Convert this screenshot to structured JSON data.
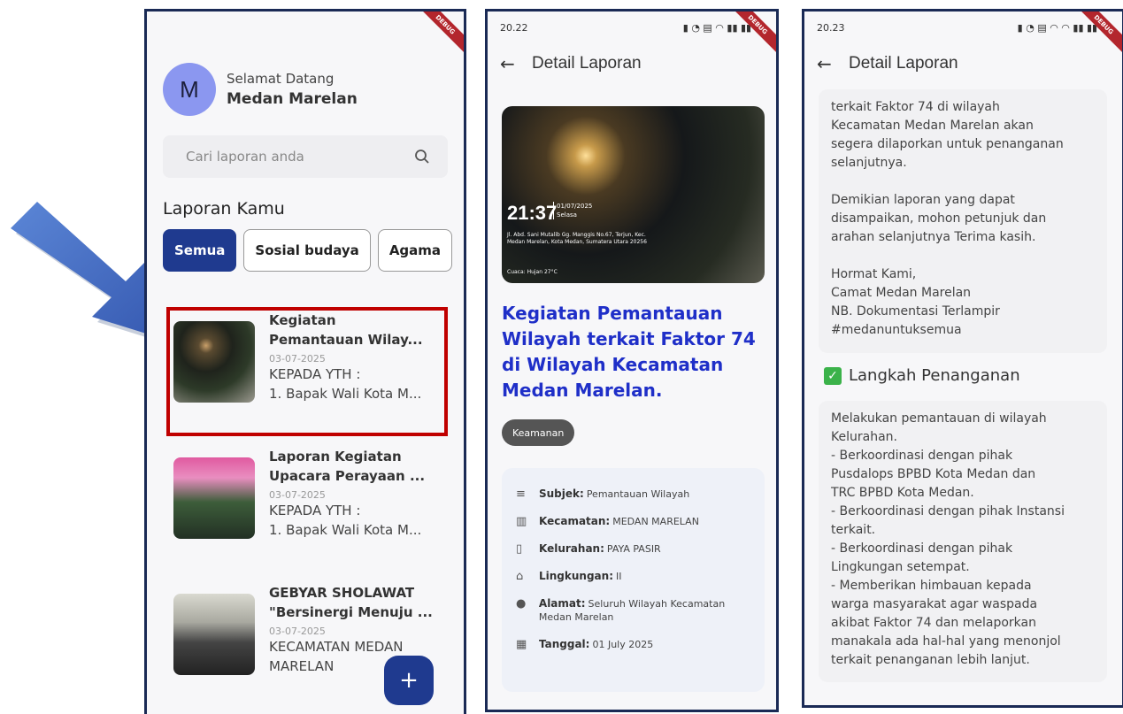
{
  "screen1": {
    "greeting": "Selamat Datang",
    "user_name": "Medan Marelan",
    "avatar_letter": "M",
    "search_placeholder": "Cari laporan anda",
    "section_title": "Laporan Kamu",
    "chips": [
      "Semua",
      "Sosial budaya",
      "Agama"
    ],
    "reports": [
      {
        "title": "Kegiatan\nPemantauan Wilay...",
        "date": "03-07-2025",
        "body": "KEPADA YTH :\n1. Bapak Wali Kota M..."
      },
      {
        "title": "Laporan Kegiatan\nUpacara Perayaan ...",
        "date": "03-07-2025",
        "body": "KEPADA YTH :\n1. Bapak Wali Kota M..."
      },
      {
        "title": "GEBYAR SHOLAWAT\n\"Bersinergi Menuju ...",
        "date": "03-07-2025",
        "body": "KECAMATAN MEDAN\nMARELAN"
      }
    ],
    "fab_label": "+"
  },
  "screen2": {
    "status_time": "20.22",
    "title": "Detail Laporan",
    "photo": {
      "time": "21:37",
      "date": "01/07/2025",
      "day": "Selasa",
      "address": "Jl. Abd. Sani Mutalib Gg. Manggis No.67, Terjun, Kec. Medan Marelan, Kota Medan, Sumatera Utara 20256",
      "weather": "Cuaca: Hujan 27°C"
    },
    "report_title": "Kegiatan Pemantauan Wilayah terkait Faktor 74 di Wilayah Kecamatan Medan Marelan.",
    "tag": "Keamanan",
    "info": {
      "subjek_label": "Subjek:",
      "subjek": "Pemantauan Wilayah",
      "kecamatan_label": "Kecamatan:",
      "kecamatan": "MEDAN MARELAN",
      "kelurahan_label": "Kelurahan:",
      "kelurahan": "PAYA PASIR",
      "lingkungan_label": "Lingkungan:",
      "lingkungan": "II",
      "alamat_label": "Alamat:",
      "alamat": "Seluruh Wilayah Kecamatan Medan Marelan",
      "tanggal_label": "Tanggal:",
      "tanggal": "01 July 2025"
    }
  },
  "screen3": {
    "status_time": "20.23",
    "title": "Detail Laporan",
    "body_text": "terkait Faktor 74 di wilayah\nKecamatan Medan Marelan akan\nsegera dilaporkan untuk penanganan\nselanjutnya.\n\nDemikian laporan yang dapat\ndisampaikan, mohon petunjuk dan\narahan selanjutnya Terima kasih.\n\nHormat Kami,\nCamat Medan Marelan\nNB. Dokumentasi Terlampir\n#medanuntuksemua",
    "langkah_title": "Langkah Penanganan",
    "langkah_text": "Melakukan pemantauan di wilayah\nKelurahan.\n- Berkoordinasi dengan pihak\nPusdalops BPBD Kota Medan dan\nTRC BPBD Kota Medan.\n- Berkoordinasi dengan pihak Instansi\nterkait.\n- Berkoordinasi dengan pihak\nLingkungan setempat.\n- Memberikan himbauan kepada\nwarga masyarakat agar waspada\nakibat Faktor 74 dan melaporkan\nmanakala ada hal-hal yang menonjol\nterkait penanganan lebih lanjut."
  },
  "colors": {
    "primary": "#1f3a8f",
    "title_blue": "#1f2fc8",
    "highlight": "#c00000",
    "arrow": "#4472c4"
  }
}
